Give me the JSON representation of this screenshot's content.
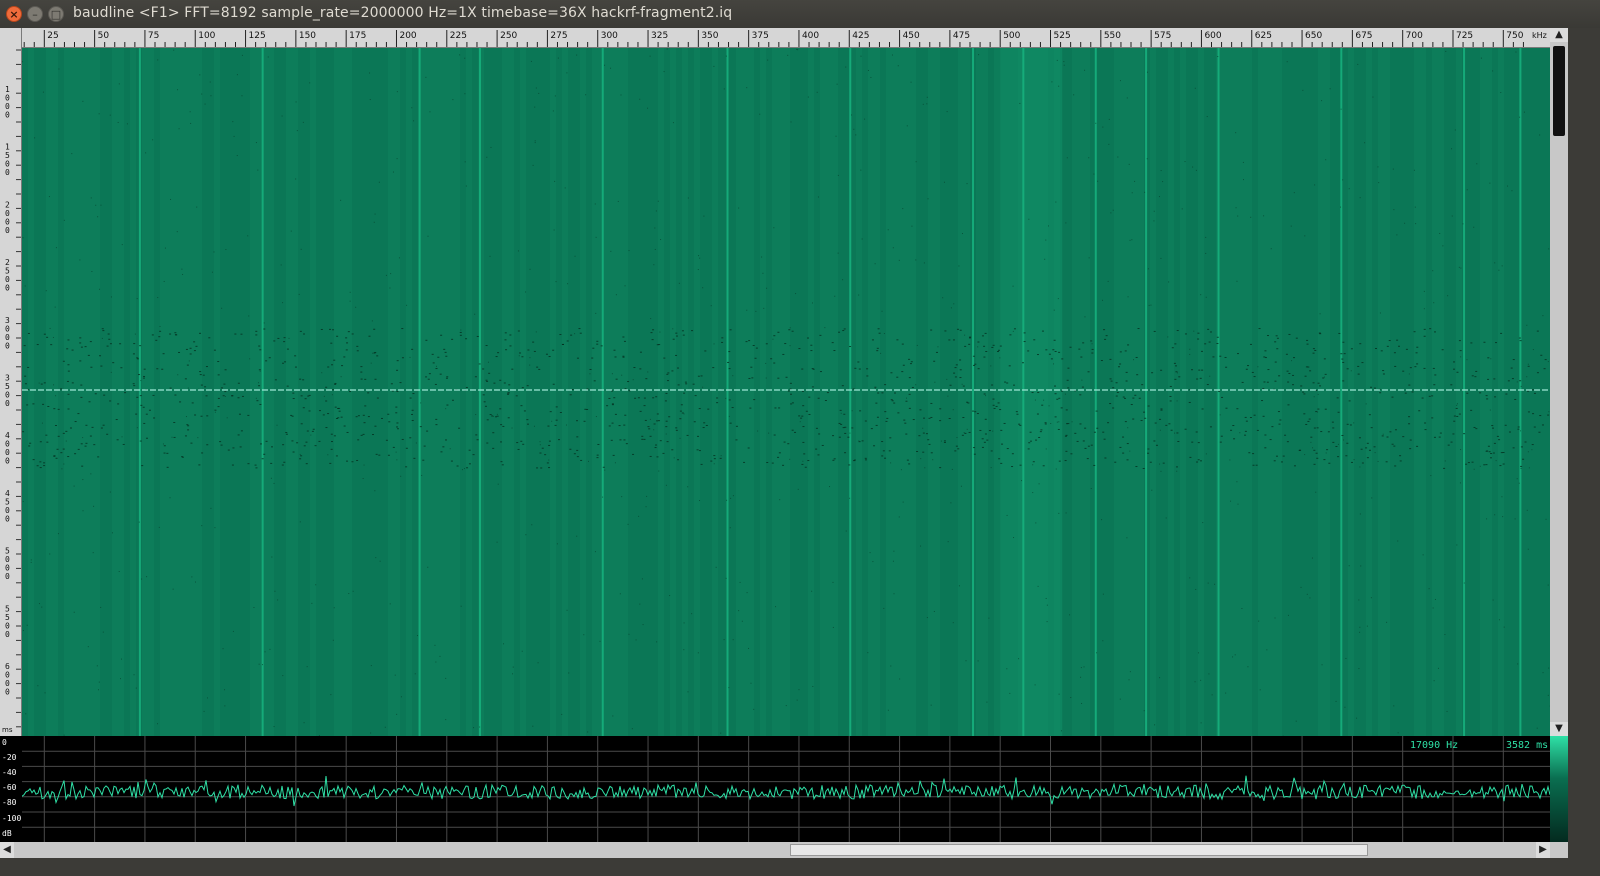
{
  "window": {
    "title": "baudline  <F1> FFT=8192 sample_rate=2000000 Hz=1X timebase=36X  hackrf-fragment2.iq",
    "close_glyph": "×",
    "minimize_glyph": "–",
    "maximize_glyph": "□"
  },
  "freq_ruler": {
    "unit": "kHz",
    "ticks": [
      "25",
      "50",
      "75",
      "100",
      "125",
      "150",
      "175",
      "200",
      "225",
      "250",
      "275",
      "300",
      "325",
      "350",
      "375",
      "400",
      "425",
      "450",
      "475",
      "500",
      "525",
      "550",
      "575",
      "600",
      "625",
      "650",
      "675",
      "700",
      "725",
      "750"
    ]
  },
  "time_axis": {
    "unit": "ms",
    "labels": [
      "1000",
      "1500",
      "2000",
      "2500",
      "3000",
      "3500",
      "4000",
      "4500",
      "5000",
      "5500",
      "6000"
    ]
  },
  "spectrum": {
    "db_labels": [
      "0",
      "-20",
      "-40",
      "-60",
      "-80",
      "-100",
      "dB"
    ],
    "frequency_readout": "17090 Hz",
    "time_readout": "3582 ms",
    "trace_color": "#2fe0a6"
  },
  "waterfall": {
    "background_color": "#0c7a58",
    "carrier_color": "#17b37f",
    "cursor_line_color": "#9fe8d6",
    "carrier_frequencies_khz": [
      72,
      133,
      211,
      241,
      302,
      364,
      425,
      486,
      511,
      547,
      572,
      608,
      669,
      730,
      758
    ]
  },
  "icons": {
    "scroll_up": "▲",
    "scroll_down": "▼",
    "scroll_left": "◀",
    "scroll_right": "▶"
  }
}
